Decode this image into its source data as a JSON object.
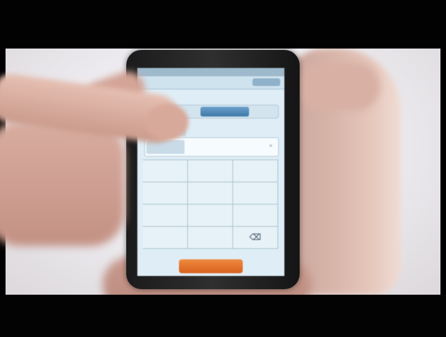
{
  "scene": {
    "description_visible": "",
    "screen": {
      "status_text": "",
      "title": "",
      "segment_left": "",
      "call_label": ""
    },
    "keypad": {
      "keys": [
        "",
        "",
        "",
        "",
        "",
        "",
        "",
        "",
        "",
        "",
        "",
        "⌫"
      ]
    },
    "colors": {
      "screen_bg": "#dfeef6",
      "accent_blue": "#3f78a8",
      "call_orange": "#d8611d",
      "skin": "#d7a99a",
      "letterbox": "#000000"
    }
  }
}
